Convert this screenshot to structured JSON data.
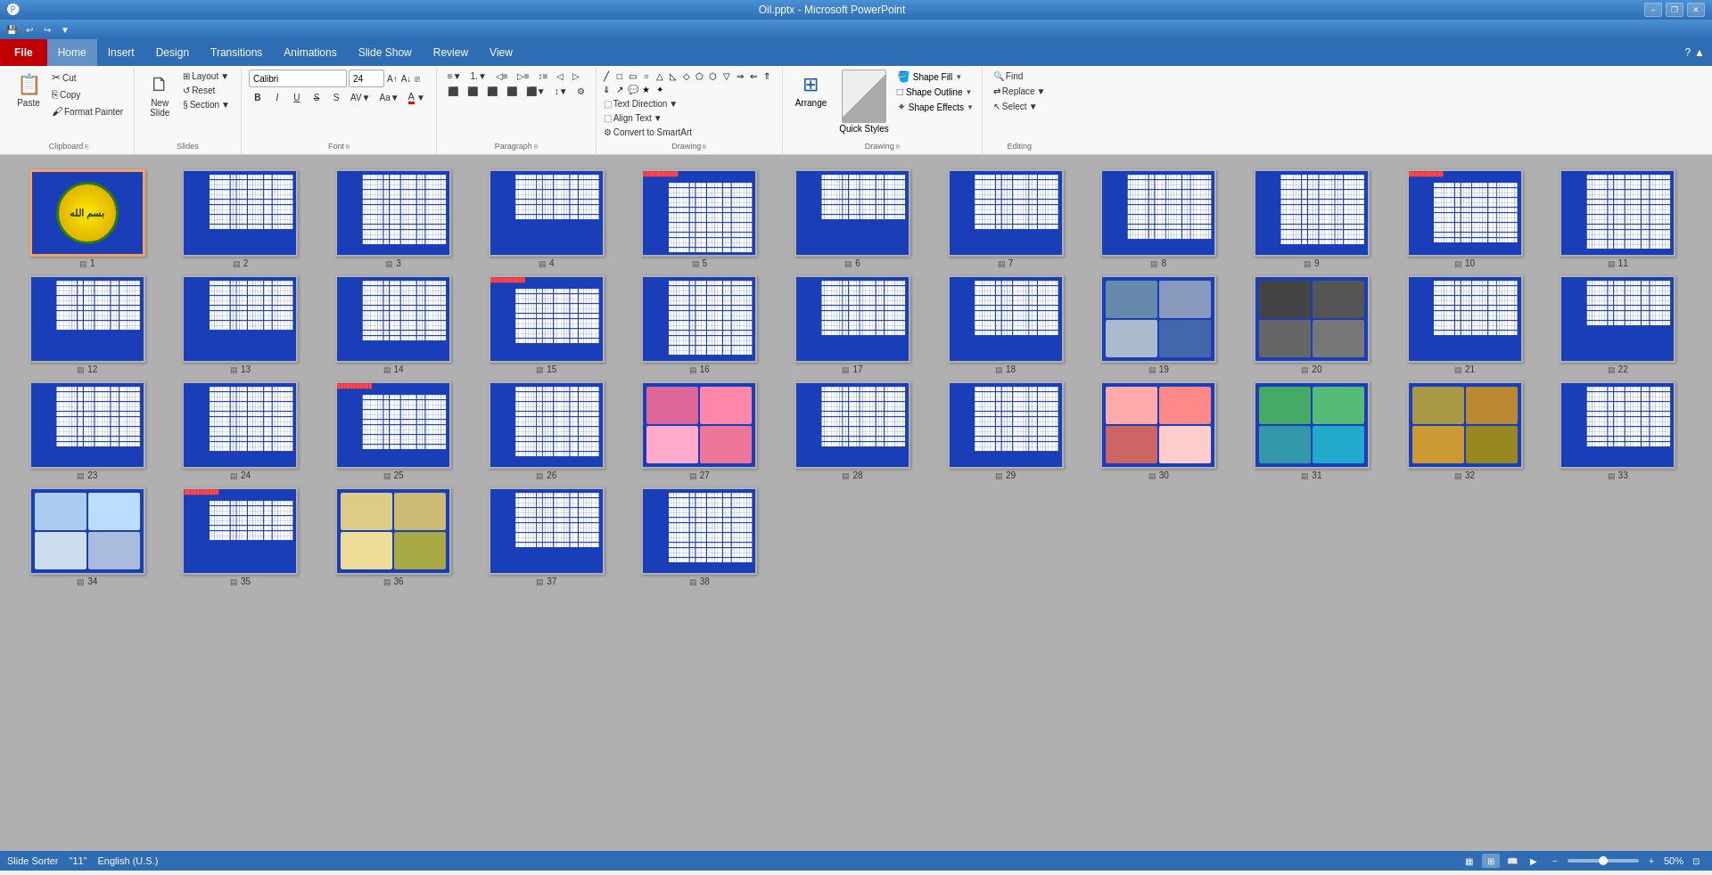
{
  "titleBar": {
    "title": "Oil.pptx - Microsoft PowerPoint",
    "minimize": "−",
    "restore": "❐",
    "close": "✕"
  },
  "qat": {
    "buttons": [
      "💾",
      "↩",
      "↪",
      "⬤"
    ]
  },
  "menuBar": {
    "file": "File",
    "items": [
      "Home",
      "Insert",
      "Design",
      "Transitions",
      "Animations",
      "Slide Show",
      "Review",
      "View"
    ]
  },
  "ribbon": {
    "groups": {
      "clipboard": {
        "label": "Clipboard",
        "paste": "Paste",
        "cut": "Cut",
        "copy": "Copy",
        "formatPainter": "Format Painter"
      },
      "slides": {
        "label": "Slides",
        "newSlide": "New Slide",
        "layout": "Layout",
        "reset": "Reset",
        "section": "Section"
      },
      "font": {
        "label": "Font",
        "fontName": "Calibri",
        "fontSize": "24",
        "bold": "B",
        "italic": "I",
        "underline": "U",
        "strikethrough": "S",
        "shadow": "S",
        "charSpacing": "AV",
        "increaseFont": "A↑",
        "decreaseFont": "A↓",
        "clearFormat": "A",
        "fontColor": "A",
        "changeCase": "Aa",
        "fontColorLabel": "A"
      },
      "paragraph": {
        "label": "Paragraph",
        "bullets": "≡",
        "numbering": "1.",
        "decreaseIndent": "◁≡",
        "increaseIndent": "▷≡",
        "colSpacing": "↕",
        "alignLeft": "⬛",
        "alignCenter": "⬛",
        "alignRight": "⬛",
        "justify": "⬛",
        "columns": "⬛",
        "lineSpacing": "↕",
        "rtl": "◁",
        "ltr": "▷",
        "convertToSmart": "Convert to SmartArt"
      },
      "drawing": {
        "label": "Drawing",
        "textDirection": "Text Direction",
        "alignText": "Align Text",
        "convertToSmartArt": "Convert to SmartArt",
        "arrange": "Arrange",
        "quickStyles": "Quick Styles",
        "shapeFill": "Shape Fill",
        "shapeOutline": "Shape Outline",
        "shapeEffects": "Shape Effects"
      },
      "editing": {
        "label": "Editing",
        "find": "Find",
        "replace": "Replace",
        "select": "Select"
      }
    }
  },
  "slides": [
    {
      "num": 1,
      "type": "logo",
      "selected": true
    },
    {
      "num": 2,
      "type": "blue-text"
    },
    {
      "num": 3,
      "type": "blue-text"
    },
    {
      "num": 4,
      "type": "blue-text"
    },
    {
      "num": 5,
      "type": "blue-text"
    },
    {
      "num": 6,
      "type": "blue-text"
    },
    {
      "num": 7,
      "type": "blue-text"
    },
    {
      "num": 8,
      "type": "blue-text"
    },
    {
      "num": 9,
      "type": "blue-text"
    },
    {
      "num": 10,
      "type": "blue-text"
    },
    {
      "num": 11,
      "type": "blue-text"
    },
    {
      "num": 12,
      "type": "blue-text"
    },
    {
      "num": 13,
      "type": "blue-text"
    },
    {
      "num": 14,
      "type": "blue-text"
    },
    {
      "num": 15,
      "type": "blue-text"
    },
    {
      "num": 16,
      "type": "blue-text"
    },
    {
      "num": 17,
      "type": "blue-text"
    },
    {
      "num": 18,
      "type": "blue-text"
    },
    {
      "num": 19,
      "type": "blue-photo",
      "photoType": "oil-rig"
    },
    {
      "num": 20,
      "type": "blue-photo",
      "photoType": "machinery"
    },
    {
      "num": 21,
      "type": "blue-text"
    },
    {
      "num": 22,
      "type": "blue-text"
    },
    {
      "num": 23,
      "type": "blue-text"
    },
    {
      "num": 24,
      "type": "blue-text"
    },
    {
      "num": 25,
      "type": "blue-text"
    },
    {
      "num": 26,
      "type": "blue-text"
    },
    {
      "num": 27,
      "type": "blue-photo",
      "photoType": "cosmetics"
    },
    {
      "num": 28,
      "type": "blue-text"
    },
    {
      "num": 29,
      "type": "blue-text"
    },
    {
      "num": 30,
      "type": "blue-photo",
      "photoType": "beauty"
    },
    {
      "num": 31,
      "type": "blue-photo",
      "photoType": "toothbrush"
    },
    {
      "num": 32,
      "type": "blue-photo",
      "photoType": "rings"
    },
    {
      "num": 33,
      "type": "blue-text"
    },
    {
      "num": 34,
      "type": "blue-photo",
      "photoType": "perfume"
    },
    {
      "num": 35,
      "type": "blue-text"
    },
    {
      "num": 36,
      "type": "blue-photo",
      "photoType": "tool"
    },
    {
      "num": 37,
      "type": "blue-text"
    },
    {
      "num": 38,
      "type": "blue-text"
    }
  ],
  "statusBar": {
    "view": "Slide Sorter",
    "slideCount": "\"11\"",
    "language": "English (U.S.)",
    "zoom": "50%"
  }
}
